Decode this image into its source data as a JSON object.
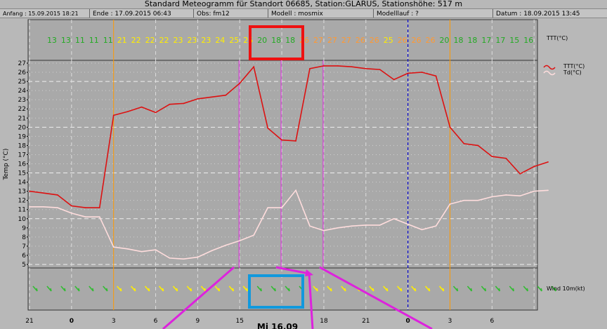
{
  "header": {
    "title": "Standard Meteogramm für Standort 06685, Station:GLARUS, Stationshöhe: 517 m",
    "anfang": "Anfang : 15.09.2015 18:21",
    "ende": "Ende : 17.09.2015 06:43",
    "obs": "Obs: fm12",
    "modell": "Modell : mosmix",
    "modelllauf": "Modelllauf : ?",
    "datum": "Datum : 18.09.2015 13:45"
  },
  "top_row": {
    "label": "TTT(°C)",
    "values": [
      "13",
      "13",
      "11",
      "11",
      "11",
      "21",
      "22",
      "22",
      "22",
      "23",
      "23",
      "23",
      "24",
      "25",
      "25",
      "20",
      "18",
      "18",
      "26",
      "27",
      "27",
      "27",
      "26",
      "26",
      "25",
      "26",
      "26",
      "26",
      "20",
      "18",
      "18",
      "17",
      "17",
      "15",
      "16"
    ],
    "colors": {
      "green": "#22aa22",
      "yellow": "#ffee00",
      "orange": "#ff9933"
    }
  },
  "wind_panel": {
    "label": "Wind 10m(kt)"
  },
  "colors": {
    "ttt": "#dd1111",
    "td": "#ffdddd",
    "midnight_line": "#ff9900",
    "now_line": "#0000cc",
    "magenta": "#dd22dd",
    "highlight_red": "#ee1111",
    "highlight_blue": "#1199dd"
  },
  "chart_data": {
    "type": "line",
    "ylabel": "Temp (°C)",
    "ylim": [
      5,
      27
    ],
    "yticks": [
      5,
      6,
      7,
      8,
      9,
      10,
      11,
      12,
      13,
      14,
      15,
      16,
      17,
      18,
      19,
      20,
      21,
      22,
      23,
      24,
      25,
      26,
      27
    ],
    "x": [
      18,
      19,
      20,
      21,
      22,
      23,
      0,
      1,
      2,
      3,
      4,
      5,
      6,
      7,
      8,
      9,
      10,
      11,
      12,
      13,
      14,
      15,
      16,
      17,
      18,
      19,
      20,
      21,
      22,
      23,
      0,
      1,
      2,
      3,
      4,
      5,
      6,
      7
    ],
    "xtick_labels": [
      "21",
      "0",
      "3",
      "6",
      "9",
      "15",
      "18",
      "21",
      "0",
      "3",
      "6"
    ],
    "xaxis_date_label": "Mi 16.09",
    "series": [
      {
        "name": "TTT(°C)",
        "values": [
          13.0,
          12.8,
          12.6,
          11.4,
          11.2,
          11.2,
          21.3,
          21.7,
          22.2,
          21.6,
          22.5,
          22.6,
          23.1,
          23.3,
          23.5,
          24.8,
          26.6,
          19.9,
          18.6,
          18.5,
          26.4,
          26.7,
          26.7,
          26.6,
          26.4,
          26.3,
          25.2,
          25.9,
          26.0,
          25.6,
          20.0,
          18.2,
          18.0,
          16.8,
          16.6,
          14.9,
          15.7,
          16.2
        ]
      },
      {
        "name": "Td(°C)",
        "values": [
          11.3,
          11.3,
          11.2,
          10.6,
          10.2,
          10.2,
          6.9,
          6.7,
          6.4,
          6.6,
          5.7,
          5.6,
          5.8,
          6.5,
          7.1,
          7.6,
          8.2,
          11.2,
          11.2,
          13.1,
          9.2,
          8.7,
          9.0,
          9.2,
          9.3,
          9.3,
          10.0,
          9.4,
          8.8,
          9.2,
          11.6,
          12.0,
          12.0,
          12.4,
          12.6,
          12.5,
          13.0,
          13.1
        ]
      }
    ],
    "wind_barbs": [
      "green",
      "green",
      "green",
      "green",
      "green",
      "green",
      "yellow",
      "yellow",
      "yellow",
      "yellow",
      "yellow",
      "yellow",
      "yellow",
      "yellow",
      "yellow",
      "yellow",
      "green",
      "green",
      "green",
      "green",
      "yellow",
      "yellow",
      "yellow",
      "yellow",
      "yellow",
      "yellow",
      "yellow",
      "yellow",
      "yellow",
      "yellow",
      "green",
      "green",
      "green",
      "green",
      "green",
      "green",
      "green",
      "green"
    ]
  }
}
